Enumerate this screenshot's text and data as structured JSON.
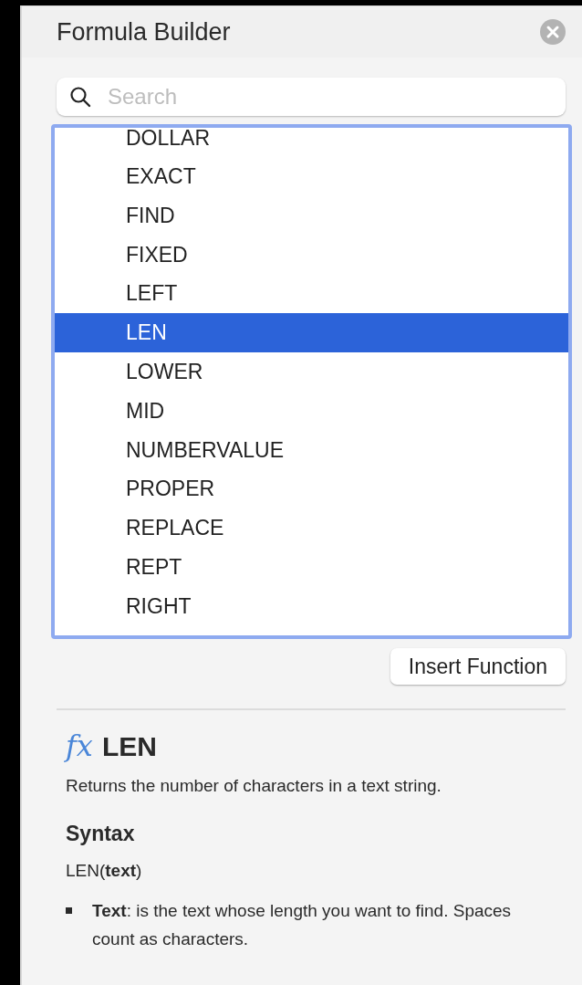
{
  "panel": {
    "title": "Formula Builder"
  },
  "search": {
    "placeholder": "Search"
  },
  "functions": [
    {
      "name": "DOLLAR",
      "selected": false
    },
    {
      "name": "EXACT",
      "selected": false
    },
    {
      "name": "FIND",
      "selected": false
    },
    {
      "name": "FIXED",
      "selected": false
    },
    {
      "name": "LEFT",
      "selected": false
    },
    {
      "name": "LEN",
      "selected": true
    },
    {
      "name": "LOWER",
      "selected": false
    },
    {
      "name": "MID",
      "selected": false
    },
    {
      "name": "NUMBERVALUE",
      "selected": false
    },
    {
      "name": "PROPER",
      "selected": false
    },
    {
      "name": "REPLACE",
      "selected": false
    },
    {
      "name": "REPT",
      "selected": false
    },
    {
      "name": "RIGHT",
      "selected": false
    }
  ],
  "insert_button": "Insert Function",
  "details": {
    "fx": "fx",
    "name": "LEN",
    "description": "Returns the number of characters in a text string.",
    "syntax_heading": "Syntax",
    "syntax": "LEN(**text**)",
    "arguments": [
      "**Text**: is the text whose length you want to find. Spaces count as characters."
    ]
  }
}
